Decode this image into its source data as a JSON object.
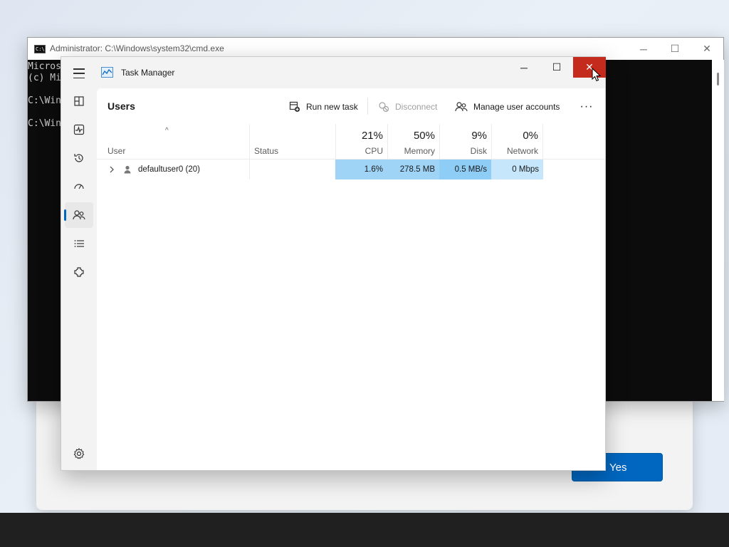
{
  "cmd": {
    "title": "Administrator: C:\\Windows\\system32\\cmd.exe",
    "icon_text": "C:\\.",
    "lines": [
      "Micros",
      "(c) Mi",
      "",
      "C:\\Win",
      "",
      "C:\\Win"
    ],
    "controls": {
      "minimize": "─",
      "maximize": "☐",
      "close": "✕"
    }
  },
  "dialog": {
    "yes_label": "Yes",
    "accent": "#0067c0"
  },
  "task_manager": {
    "title": "Task Manager",
    "controls": {
      "minimize": "─",
      "maximize": "☐",
      "close": "✕"
    },
    "nav": [
      {
        "icon": "processes-icon"
      },
      {
        "icon": "performance-icon"
      },
      {
        "icon": "app-history-icon"
      },
      {
        "icon": "startup-apps-icon"
      },
      {
        "icon": "users-icon",
        "active": true
      },
      {
        "icon": "details-icon"
      },
      {
        "icon": "services-icon"
      }
    ],
    "settings_icon": "settings-icon",
    "page_title": "Users",
    "commands": {
      "run_new_task": "Run new task",
      "disconnect": "Disconnect",
      "manage_accounts": "Manage user accounts",
      "more": "···"
    },
    "columns": {
      "user": "User",
      "status": "Status",
      "cpu": {
        "pct": "21%",
        "name": "CPU"
      },
      "memory": {
        "pct": "50%",
        "name": "Memory"
      },
      "disk": {
        "pct": "9%",
        "name": "Disk"
      },
      "network": {
        "pct": "0%",
        "name": "Network"
      }
    },
    "sort_indicator": "^",
    "rows": [
      {
        "name": "defaultuser0 (20)",
        "status": "",
        "cpu": "1.6%",
        "memory": "278.5 MB",
        "disk": "0.5 MB/s",
        "network": "0 Mbps"
      }
    ],
    "heat_colors": {
      "cpu": "#9fd4f7",
      "memory": "#9fd4f7",
      "disk": "#8ecdf5",
      "network": "#c6e6fb"
    }
  }
}
